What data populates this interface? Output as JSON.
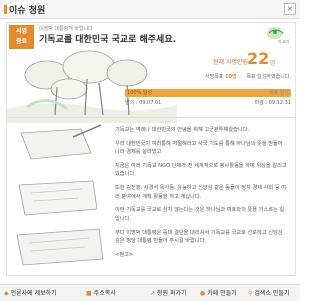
{
  "topbar": {
    "title": "이슈 청원",
    "close_icon": "close-icon"
  },
  "badge": {
    "line1": "서명",
    "line2": "중료"
  },
  "header": {
    "small_text": "이명박 대통령께 바랍니다",
    "headline": "기독교를 대한민국 국교로 해주세요.",
    "logo_text": "아고라"
  },
  "count": {
    "label": "현재 서명인원",
    "number": "22",
    "unit": "명"
  },
  "stats": {
    "goal_label": "서명목표",
    "goal_value": "10명",
    "status": "목표 달성하였습니다."
  },
  "progress": {
    "percent": 100,
    "percent_label": "100% 달성",
    "end_label": "목표 달성"
  },
  "dates": {
    "start_label": "발의 : 09.07.01",
    "end_label": "마감 : 09.12.31"
  },
  "body": [
    "기독교는 역례나 대한민국의 안녕을 위해 고군분투해왔습니다.",
    "우리 대한민국이 여러통해 처절해라고 사국 기도를 통해 하나님의 뜻을 받들어 나라 경제를 살려냈고",
    "지금은 여러 기독교 NGO 단체가 전 세계적으로 봉사활동을 하며 위상을 알리고 있습니다.",
    "또한 김진홍, 서경석 목사등, 유능하고 신앙심 같은 동들이 정치 경제 사회 등 여러 분야에서 계획 활동을 하고 계십니다.",
    "이런 기독교를 국교로 삼지 않는다는 것은 하나님과 여호와의 뜻을 거스르는 일입니다.",
    "부디 이명박 대통령은 중대 결단을 내리셔서 기독교를 국교로 선포하고 신앙심 깊은 정당 대통령 만들어 주시길 바랍니다.",
    "<참고>"
  ],
  "bottombar": {
    "btn1": "언론사에 제보하기",
    "btn2": "주소복사",
    "btn3": "청원 퍼가기",
    "btn4": "카페 만들기",
    "btn5": "검색소 만들기"
  },
  "colors": {
    "accent": "#e58a2c",
    "progress": "#f2a43c",
    "green": "#4a9b50"
  }
}
